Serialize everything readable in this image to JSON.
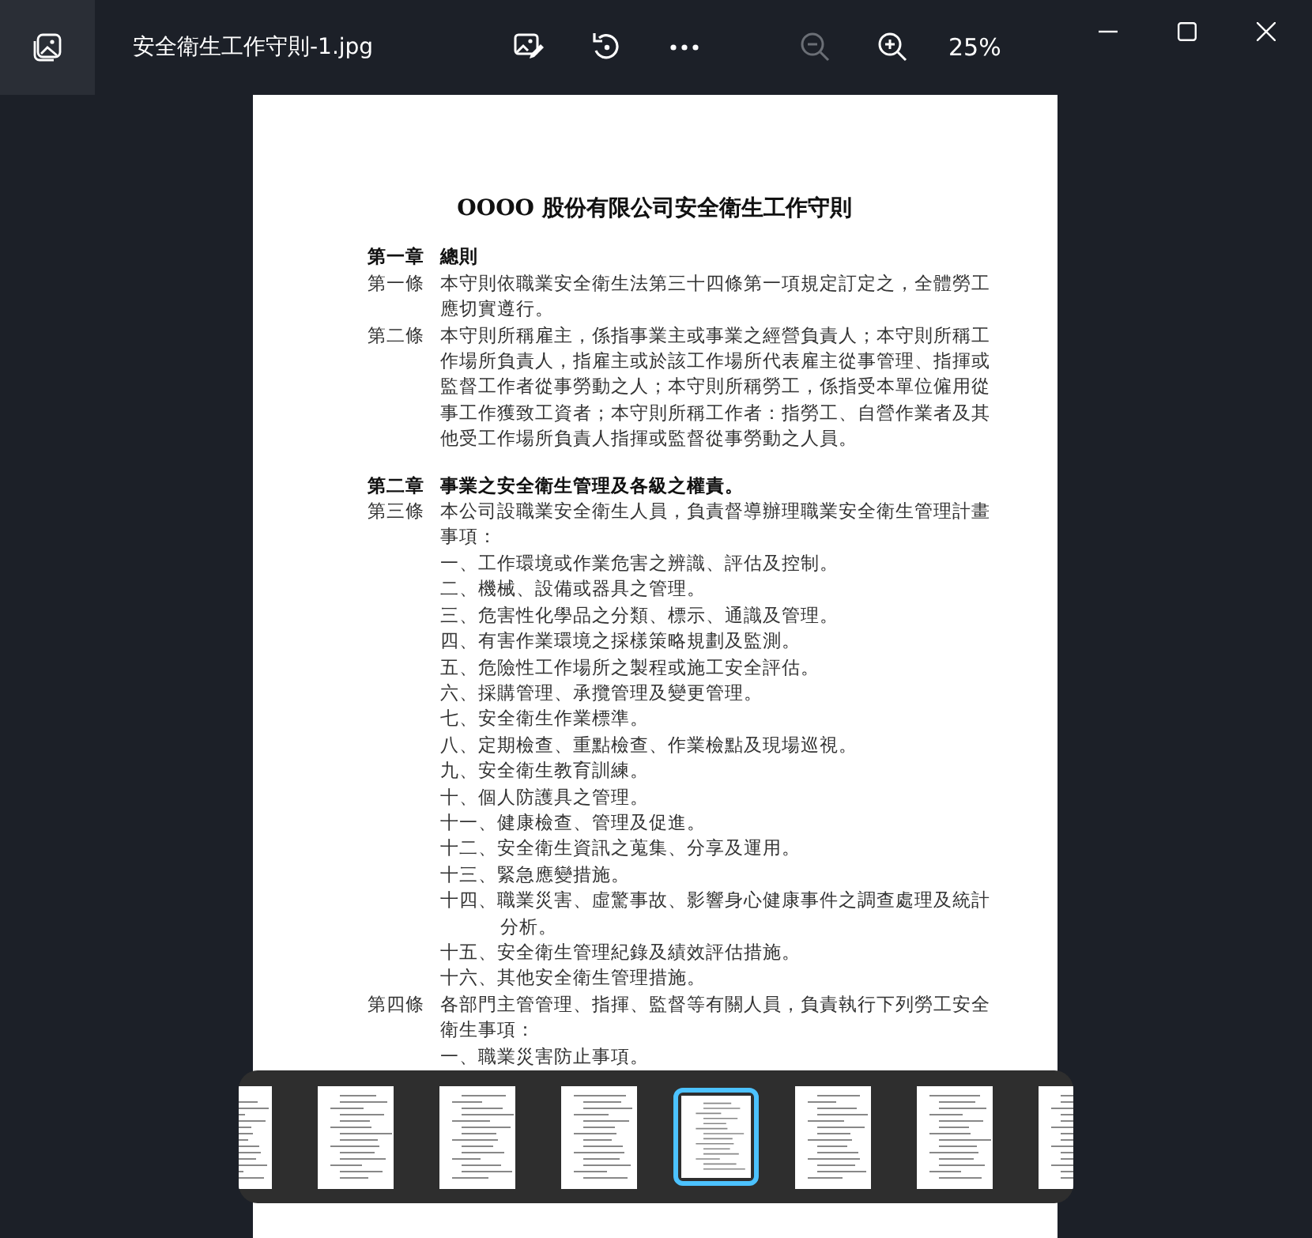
{
  "window": {
    "title": "安全衛生工作守則-1.jpg"
  },
  "toolbar": [
    {
      "kind": "edit",
      "disabled": false
    },
    {
      "kind": "rotate",
      "disabled": false
    },
    {
      "kind": "more",
      "disabled": false
    },
    {
      "kind": "zoom-out",
      "disabled": true
    },
    {
      "kind": "zoom-in",
      "disabled": false
    }
  ],
  "zoom_level": "25%",
  "document": {
    "title": "OOOO 股份有限公司安全衛生工作守則",
    "blocks": [
      {
        "kind": "chapter",
        "label": "第一章",
        "text": "總則"
      },
      {
        "kind": "article",
        "label": "第一條",
        "text": "本守則依職業安全衛生法第三十四條第一項規定訂定之，全體勞工應切實遵行。"
      },
      {
        "kind": "article",
        "label": "第二條",
        "text": "本守則所稱雇主，係指事業主或事業之經營負責人；本守則所稱工作場所負責人，指雇主或於該工作場所代表雇主從事管理、指揮或監督工作者從事勞動之人；本守則所稱勞工，係指受本單位僱用從事工作獲致工資者；本守則所稱工作者：指勞工、自營作業者及其他受工作場所負責人指揮或監督從事勞動之人員。"
      },
      {
        "kind": "chapter",
        "label": "第二章",
        "text": "事業之安全衛生管理及各級之權責。"
      },
      {
        "kind": "article",
        "label": "第三條",
        "text": "本公司設職業安全衛生人員，負責督導辦理職業安全衛生管理計畫事項："
      },
      {
        "kind": "item",
        "text": "一、工作環境或作業危害之辨識、評估及控制。"
      },
      {
        "kind": "item",
        "text": "二、機械、設備或器具之管理。"
      },
      {
        "kind": "item",
        "text": "三、危害性化學品之分類、標示、通識及管理。"
      },
      {
        "kind": "item",
        "text": "四、有害作業環境之採樣策略規劃及監測。"
      },
      {
        "kind": "item",
        "text": "五、危險性工作場所之製程或施工安全評估。"
      },
      {
        "kind": "item",
        "text": "六、採購管理、承攬管理及變更管理。"
      },
      {
        "kind": "item",
        "text": "七、安全衛生作業標準。"
      },
      {
        "kind": "item",
        "text": "八、定期檢查、重點檢查、作業檢點及現場巡視。"
      },
      {
        "kind": "item",
        "text": "九、安全衛生教育訓練。"
      },
      {
        "kind": "item",
        "text": "十、個人防護具之管理。"
      },
      {
        "kind": "item",
        "text": "十一、健康檢查、管理及促進。"
      },
      {
        "kind": "item",
        "text": "十二、安全衛生資訊之蒐集、分享及運用。"
      },
      {
        "kind": "item",
        "text": "十三、緊急應變措施。"
      },
      {
        "kind": "item",
        "text": "十四、職業災害、虛驚事故、影響身心健康事件之調查處理及統計分析。"
      },
      {
        "kind": "item",
        "text": "十五、安全衛生管理紀錄及績效評估措施。"
      },
      {
        "kind": "item",
        "text": "十六、其他安全衛生管理措施。"
      },
      {
        "kind": "article",
        "label": "第四條",
        "text": "各部門主管管理、指揮、監督等有關人員，負責執行下列勞工安全衛生事項："
      },
      {
        "kind": "item",
        "text": "一、職業災害防止事項。"
      }
    ]
  },
  "thumbnails": [
    {
      "selected": false
    },
    {
      "selected": false
    },
    {
      "selected": false
    },
    {
      "selected": false
    },
    {
      "selected": true
    },
    {
      "selected": false
    },
    {
      "selected": false
    },
    {
      "selected": false
    }
  ]
}
